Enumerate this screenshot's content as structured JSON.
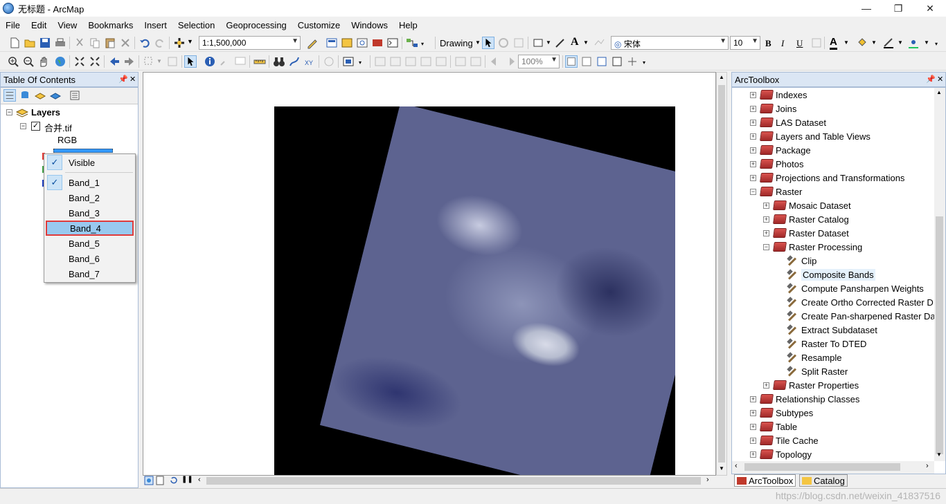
{
  "window": {
    "title": "无标题 - ArcMap",
    "minimize": "—",
    "maximize": "❐",
    "close": "✕"
  },
  "menu": [
    "File",
    "Edit",
    "View",
    "Bookmarks",
    "Insert",
    "Selection",
    "Geoprocessing",
    "Customize",
    "Windows",
    "Help"
  ],
  "toolbar": {
    "scale": "1:1,500,000",
    "drawing_label": "Drawing",
    "font": "宋体",
    "font_size": "10",
    "zoom": "100%",
    "bold": "B",
    "italic": "I",
    "underline": "U",
    "text_A": "A"
  },
  "toc": {
    "title": "Table Of Contents",
    "layers_label": "Layers",
    "layer_name": "合并.tif",
    "rgb_label": "RGB"
  },
  "context_menu": {
    "items": [
      {
        "label": "Visible",
        "checked": true
      },
      {
        "label": "Band_1",
        "checked": true
      },
      {
        "label": "Band_2",
        "checked": false
      },
      {
        "label": "Band_3",
        "checked": false
      },
      {
        "label": "Band_4",
        "checked": false,
        "selected": true
      },
      {
        "label": "Band_5",
        "checked": false
      },
      {
        "label": "Band_6",
        "checked": false
      },
      {
        "label": "Band_7",
        "checked": false
      }
    ]
  },
  "arctoolbox": {
    "title": "ArcToolbox",
    "rows": [
      {
        "label": "Indexes",
        "type": "toolbox",
        "level": 0,
        "exp": "+"
      },
      {
        "label": "Joins",
        "type": "toolbox",
        "level": 0,
        "exp": "+"
      },
      {
        "label": "LAS Dataset",
        "type": "toolbox",
        "level": 0,
        "exp": "+"
      },
      {
        "label": "Layers and Table Views",
        "type": "toolbox",
        "level": 0,
        "exp": "+"
      },
      {
        "label": "Package",
        "type": "toolbox",
        "level": 0,
        "exp": "+"
      },
      {
        "label": "Photos",
        "type": "toolbox",
        "level": 0,
        "exp": "+"
      },
      {
        "label": "Projections and Transformations",
        "type": "toolbox",
        "level": 0,
        "exp": "+"
      },
      {
        "label": "Raster",
        "type": "toolbox",
        "level": 0,
        "exp": "−"
      },
      {
        "label": "Mosaic Dataset",
        "type": "toolbox",
        "level": 1,
        "exp": "+"
      },
      {
        "label": "Raster Catalog",
        "type": "toolbox",
        "level": 1,
        "exp": "+"
      },
      {
        "label": "Raster Dataset",
        "type": "toolbox",
        "level": 1,
        "exp": "+"
      },
      {
        "label": "Raster Processing",
        "type": "toolbox",
        "level": 1,
        "exp": "−"
      },
      {
        "label": "Clip",
        "type": "tool",
        "level": 2
      },
      {
        "label": "Composite Bands",
        "type": "tool",
        "level": 2,
        "hover": true
      },
      {
        "label": "Compute Pansharpen Weights",
        "type": "tool",
        "level": 2
      },
      {
        "label": "Create Ortho Corrected Raster D",
        "type": "tool",
        "level": 2
      },
      {
        "label": "Create Pan-sharpened Raster Da",
        "type": "tool",
        "level": 2
      },
      {
        "label": "Extract Subdataset",
        "type": "tool",
        "level": 2
      },
      {
        "label": "Raster To DTED",
        "type": "tool",
        "level": 2
      },
      {
        "label": "Resample",
        "type": "tool",
        "level": 2
      },
      {
        "label": "Split Raster",
        "type": "tool",
        "level": 2
      },
      {
        "label": "Raster Properties",
        "type": "toolbox",
        "level": 1,
        "exp": "+"
      },
      {
        "label": "Relationship Classes",
        "type": "toolbox",
        "level": 0,
        "exp": "+"
      },
      {
        "label": "Subtypes",
        "type": "toolbox",
        "level": 0,
        "exp": "+"
      },
      {
        "label": "Table",
        "type": "toolbox",
        "level": 0,
        "exp": "+"
      },
      {
        "label": "Tile Cache",
        "type": "toolbox",
        "level": 0,
        "exp": "+"
      },
      {
        "label": "Topology",
        "type": "toolbox",
        "level": 0,
        "exp": "+"
      }
    ]
  },
  "tabs": {
    "arctoolbox": "ArcToolbox",
    "catalog": "Catalog"
  },
  "watermark": "https://blog.csdn.net/weixin_41837516"
}
